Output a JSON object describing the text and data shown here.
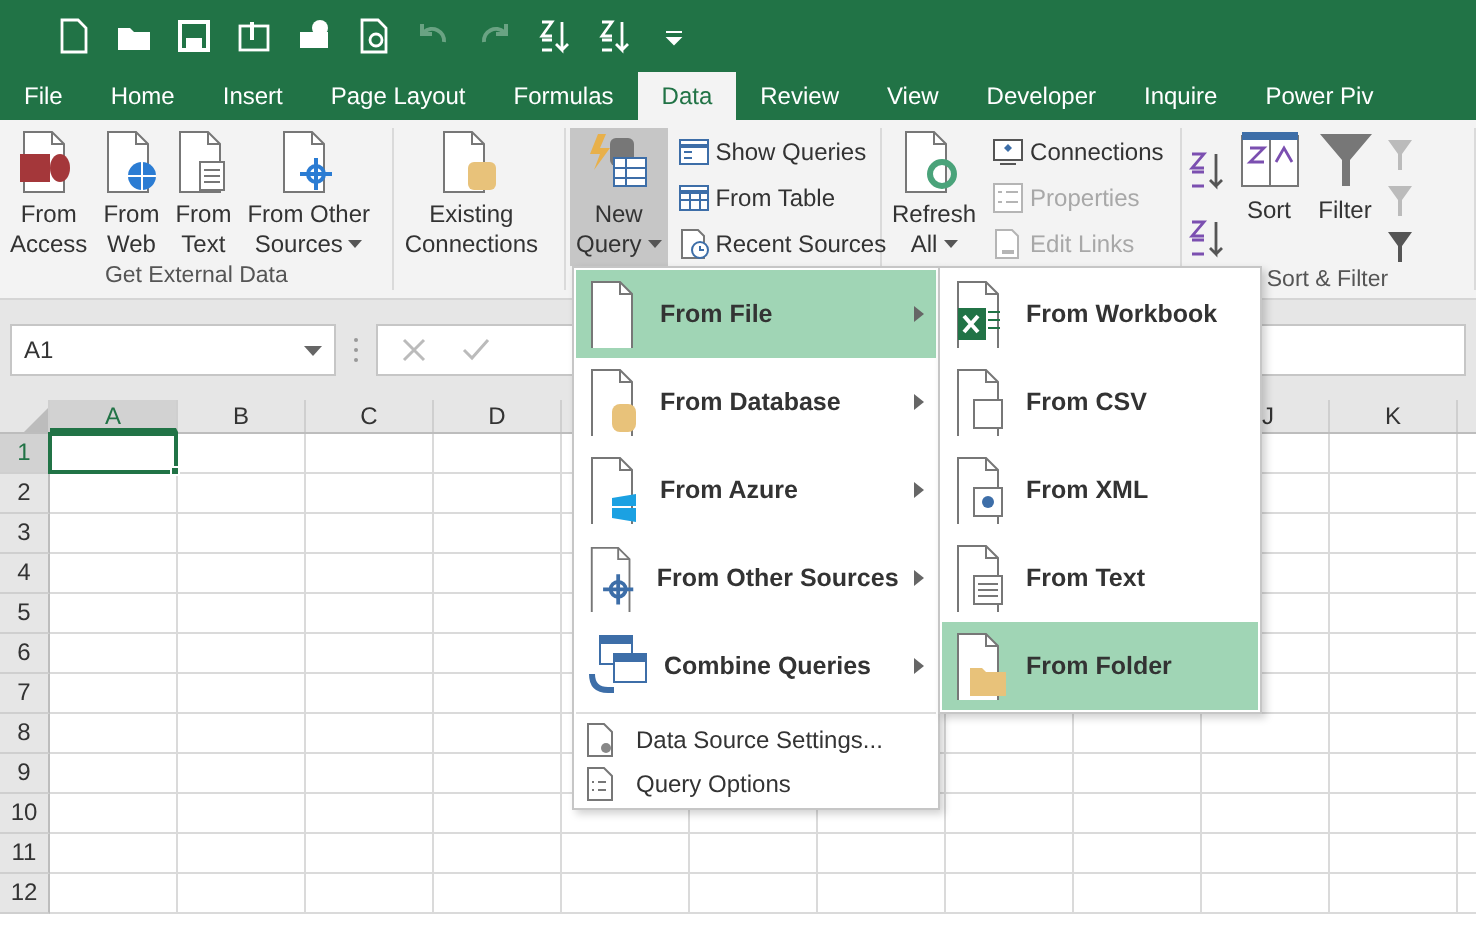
{
  "tabs": [
    {
      "label": "File",
      "selected": false
    },
    {
      "label": "Home",
      "selected": false
    },
    {
      "label": "Insert",
      "selected": false
    },
    {
      "label": "Page Layout",
      "selected": false
    },
    {
      "label": "Formulas",
      "selected": false
    },
    {
      "label": "Data",
      "selected": true
    },
    {
      "label": "Review",
      "selected": false
    },
    {
      "label": "View",
      "selected": false
    },
    {
      "label": "Developer",
      "selected": false
    },
    {
      "label": "Inquire",
      "selected": false
    },
    {
      "label": "Power Piv",
      "selected": false
    }
  ],
  "ribbon": {
    "get_external_data": {
      "label": "Get External Data",
      "buttons": [
        {
          "kind": "access",
          "lines": [
            "From",
            "Access"
          ],
          "dropdown": false
        },
        {
          "kind": "web",
          "lines": [
            "From",
            "Web"
          ],
          "dropdown": false
        },
        {
          "kind": "text",
          "lines": [
            "From",
            "Text"
          ],
          "dropdown": false
        },
        {
          "kind": "other",
          "lines": [
            "From Other",
            "Sources"
          ],
          "dropdown": true
        }
      ]
    },
    "existing_connections": {
      "lines": [
        "Existing",
        "Connections"
      ]
    },
    "new_query": {
      "lines": [
        "New",
        "Query"
      ],
      "dropdown": true,
      "pressed": true,
      "items": [
        {
          "kind": "show",
          "label": "Show Queries",
          "disabled": false
        },
        {
          "kind": "table",
          "label": "From Table",
          "disabled": false
        },
        {
          "kind": "recent",
          "label": "Recent Sources",
          "disabled": false
        }
      ]
    },
    "connections": {
      "refresh": {
        "lines": [
          "Refresh",
          "All"
        ],
        "dropdown": true
      },
      "items": [
        {
          "kind": "connections",
          "label": "Connections",
          "disabled": false
        },
        {
          "kind": "properties",
          "label": "Properties",
          "disabled": true
        },
        {
          "kind": "links",
          "label": "Edit Links",
          "disabled": true
        }
      ]
    },
    "sort_filter": {
      "label": "Sort & Filter",
      "sort": "Sort",
      "filter": "Filter"
    }
  },
  "name_box": {
    "value": "A1"
  },
  "sheet": {
    "columns": [
      {
        "kind": "header",
        "label": "A",
        "selected": true
      },
      {
        "kind": "header",
        "label": "B",
        "selected": false
      },
      {
        "kind": "header",
        "label": "C",
        "selected": false
      },
      {
        "kind": "header",
        "label": "D",
        "selected": false
      },
      {
        "kind": "covered"
      },
      {
        "kind": "covered"
      },
      {
        "kind": "covered"
      },
      {
        "kind": "covered"
      },
      {
        "kind": "covered"
      },
      {
        "kind": "partial",
        "label": "J",
        "selected": false
      },
      {
        "kind": "header",
        "label": "K",
        "selected": false
      }
    ],
    "rows": [
      {
        "label": "1",
        "selected": true
      },
      {
        "label": "2",
        "selected": false
      },
      {
        "label": "3",
        "selected": false
      },
      {
        "label": "4",
        "selected": false
      },
      {
        "label": "5",
        "selected": false
      },
      {
        "label": "6",
        "selected": false
      },
      {
        "label": "7",
        "selected": false
      },
      {
        "label": "8",
        "selected": false
      },
      {
        "label": "9",
        "selected": false
      },
      {
        "label": "10",
        "selected": false
      },
      {
        "label": "11",
        "selected": false
      },
      {
        "label": "12",
        "selected": false
      }
    ]
  },
  "new_query_menu": {
    "items": [
      {
        "kind": "file",
        "label": "From File",
        "submenu": true,
        "selected": true
      },
      {
        "kind": "database",
        "label": "From Database",
        "submenu": true,
        "selected": false
      },
      {
        "kind": "azure",
        "label": "From Azure",
        "submenu": true,
        "selected": false
      },
      {
        "kind": "other",
        "label": "From Other Sources",
        "submenu": true,
        "selected": false
      },
      {
        "kind": "combine",
        "label": "Combine Queries",
        "submenu": true,
        "selected": false
      }
    ],
    "footer_items": [
      {
        "kind": "settings",
        "label": "Data Source Settings..."
      },
      {
        "kind": "options",
        "label": "Query Options"
      }
    ]
  },
  "from_file_menu": {
    "items": [
      {
        "kind": "workbook",
        "label": "From Workbook",
        "selected": false
      },
      {
        "kind": "csv",
        "label": "From CSV",
        "selected": false
      },
      {
        "kind": "xml",
        "label": "From XML",
        "selected": false
      },
      {
        "kind": "text",
        "label": "From Text",
        "selected": false
      },
      {
        "kind": "folder",
        "label": "From Folder",
        "selected": true
      }
    ]
  }
}
